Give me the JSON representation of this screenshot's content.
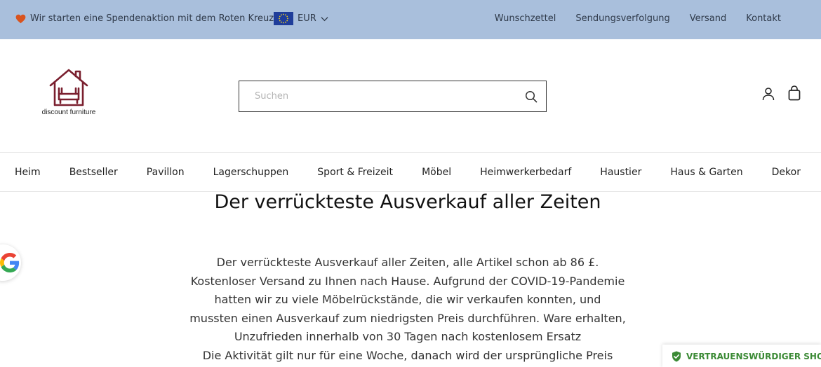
{
  "topbar": {
    "promo_text": "Wir starten eine Spendenaktion mit dem Roten Kreuz*",
    "currency": "EUR",
    "links": [
      "Wunschzettel",
      "Sendungsverfolgung",
      "Versand",
      "Kontakt"
    ]
  },
  "header": {
    "logo_text": "discount furniture",
    "search_placeholder": "Suchen"
  },
  "nav": {
    "items": [
      "Heim",
      "Bestseller",
      "Pavillon",
      "Lagerschuppen",
      "Sport & Freizeit",
      "Möbel",
      "Heimwerkerbedarf",
      "Haustier",
      "Haus & Garten",
      "Dekor"
    ]
  },
  "main": {
    "title": "Der verrückteste Ausverkauf aller Zeiten",
    "paragraph1": "Der verrückteste Ausverkauf aller Zeiten, alle Artikel schon ab 86 £. Kostenloser Versand zu Ihnen nach Hause. Aufgrund der COVID-19-Pandemie hatten wir zu viele Möbelrückstände, die wir verkaufen konnten, und mussten einen Ausverkauf zum niedrigsten Preis durchführen. Ware erhalten, Unzufrieden innerhalb von 30 Tagen nach kostenlosem Ersatz",
    "paragraph2": "Die Aktivität gilt nur für eine Woche, danach wird der ursprüngliche Preis"
  },
  "trust_badge": {
    "label": "VERTRAUENSWÜRDIGER SHOP"
  },
  "colors": {
    "topbar_bg": "#a9bfdc",
    "logo": "#7a1f2e",
    "heart": "#d9531e",
    "trust_green": "#3b8a35"
  },
  "icons": [
    "heart-icon",
    "eu-flag-icon",
    "chevron-down-icon",
    "search-icon",
    "account-icon",
    "cart-icon",
    "google-icon",
    "shield-check-icon"
  ]
}
